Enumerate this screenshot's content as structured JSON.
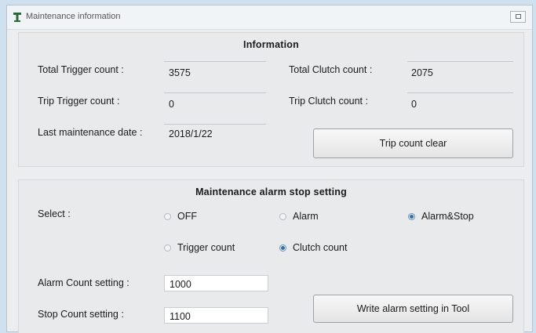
{
  "window": {
    "title": "Maintenance information"
  },
  "info": {
    "title": "Information",
    "total_trigger_label": "Total Trigger count :",
    "total_trigger_value": "3575",
    "total_clutch_label": "Total Clutch count :",
    "total_clutch_value": "2075",
    "trip_trigger_label": "Trip Trigger count :",
    "trip_trigger_value": "0",
    "trip_clutch_label": "Trip Clutch count :",
    "trip_clutch_value": "0",
    "last_maint_label": "Last maintenance date :",
    "last_maint_value": "2018/1/22",
    "trip_clear_button": "Trip count clear"
  },
  "alarm": {
    "title": "Maintenance alarm stop setting",
    "select_label": "Select :",
    "mode_options": [
      {
        "label": "OFF",
        "selected": false
      },
      {
        "label": "Alarm",
        "selected": false
      },
      {
        "label": "Alarm&Stop",
        "selected": true
      }
    ],
    "count_options": [
      {
        "label": "Trigger count",
        "selected": false
      },
      {
        "label": "Clutch count",
        "selected": true
      }
    ],
    "alarm_count_label": "Alarm Count setting :",
    "alarm_count_value": "1000",
    "stop_count_label": "Stop Count setting :",
    "stop_count_value": "1100",
    "write_button": "Write alarm setting in Tool"
  },
  "colors": {
    "accent": "#2e6fb5",
    "window_bg": "#ebedef"
  },
  "icons": {
    "app": "tool-icon",
    "maximize": "maximize-icon"
  }
}
